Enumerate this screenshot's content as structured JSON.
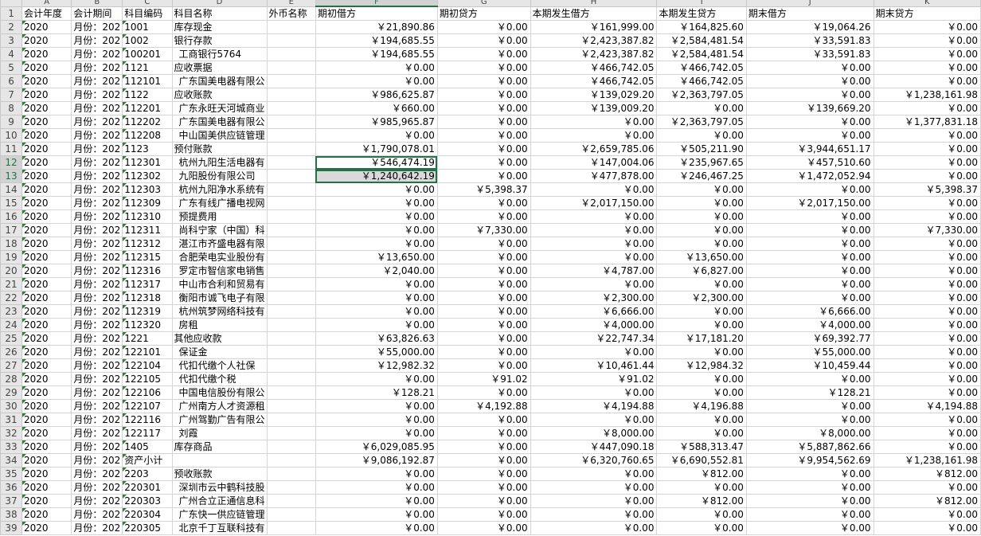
{
  "columns": [
    "A",
    "B",
    "C",
    "D",
    "E",
    "F",
    "G",
    "H",
    "I",
    "J",
    "K"
  ],
  "headers": [
    "会计年度",
    "会计期间",
    "科目编码",
    "科目名称",
    "外币名称",
    "期初借方",
    "期初贷方",
    "本期发生借方",
    "本期发生贷方",
    "期末借方",
    "期末贷方"
  ],
  "rows": [
    [
      "2020",
      "月份：202",
      "1001",
      "库存现金",
      "",
      "￥21,890.86",
      "￥0.00",
      "￥161,999.00",
      "￥164,825.60",
      "￥19,064.26",
      "￥0.00"
    ],
    [
      "2020",
      "月份：202",
      "1002",
      "银行存款",
      "",
      "￥194,685.55",
      "￥0.00",
      "￥2,423,387.82",
      "￥2,584,481.54",
      "￥33,591.83",
      "￥0.00"
    ],
    [
      "2020",
      "月份：202",
      "100201",
      "工商银行5764",
      "",
      "￥194,685.55",
      "￥0.00",
      "￥2,423,387.82",
      "￥2,584,481.54",
      "￥33,591.83",
      "￥0.00"
    ],
    [
      "2020",
      "月份：202",
      "1121",
      "应收票据",
      "",
      "￥0.00",
      "￥0.00",
      "￥466,742.05",
      "￥466,742.05",
      "￥0.00",
      "￥0.00"
    ],
    [
      "2020",
      "月份：202",
      "112101",
      "广东国美电器有限公",
      "",
      "￥0.00",
      "￥0.00",
      "￥466,742.05",
      "￥466,742.05",
      "￥0.00",
      "￥0.00"
    ],
    [
      "2020",
      "月份：202",
      "1122",
      "应收账款",
      "",
      "￥986,625.87",
      "￥0.00",
      "￥139,029.20",
      "￥2,363,797.05",
      "￥0.00",
      "￥1,238,161.98"
    ],
    [
      "2020",
      "月份：202",
      "112201",
      "广东永旺天河城商业",
      "",
      "￥660.00",
      "￥0.00",
      "￥139,009.20",
      "￥0.00",
      "￥139,669.20",
      "￥0.00"
    ],
    [
      "2020",
      "月份：202",
      "112202",
      "广东国美电器有限公",
      "",
      "￥985,965.87",
      "￥0.00",
      "￥0.00",
      "￥2,363,797.05",
      "￥0.00",
      "￥1,377,831.18"
    ],
    [
      "2020",
      "月份：202",
      "112208",
      "中山国美供应链管理",
      "",
      "￥0.00",
      "￥0.00",
      "￥0.00",
      "￥0.00",
      "￥0.00",
      "￥0.00"
    ],
    [
      "2020",
      "月份：202",
      "1123",
      "预付账款",
      "",
      "￥1,790,078.01",
      "￥0.00",
      "￥2,659,785.06",
      "￥505,211.90",
      "￥3,944,651.17",
      "￥0.00"
    ],
    [
      "2020",
      "月份：202",
      "112301",
      "杭州九阳生活电器有",
      "",
      "￥546,474.19",
      "￥0.00",
      "￥147,004.06",
      "￥235,967.65",
      "￥457,510.60",
      "￥0.00"
    ],
    [
      "2020",
      "月份：202",
      "112302",
      "九阳股份有限公司",
      "",
      "￥1,240,642.19",
      "￥0.00",
      "￥477,878.00",
      "￥246,467.25",
      "￥1,472,052.94",
      "￥0.00"
    ],
    [
      "2020",
      "月份：202",
      "112303",
      "杭州九阳净水系统有",
      "",
      "￥0.00",
      "￥5,398.37",
      "￥0.00",
      "￥0.00",
      "￥0.00",
      "￥5,398.37"
    ],
    [
      "2020",
      "月份：202",
      "112309",
      "广东有线广播电视网",
      "",
      "￥0.00",
      "￥0.00",
      "￥2,017,150.00",
      "￥0.00",
      "￥2,017,150.00",
      "￥0.00"
    ],
    [
      "2020",
      "月份：202",
      "112310",
      "预提费用",
      "",
      "￥0.00",
      "￥0.00",
      "￥0.00",
      "￥0.00",
      "￥0.00",
      "￥0.00"
    ],
    [
      "2020",
      "月份：202",
      "112311",
      "尚科宁家（中国）科",
      "",
      "￥0.00",
      "￥7,330.00",
      "￥0.00",
      "￥0.00",
      "￥0.00",
      "￥7,330.00"
    ],
    [
      "2020",
      "月份：202",
      "112312",
      "湛江市齐盛电器有限",
      "",
      "￥0.00",
      "￥0.00",
      "￥0.00",
      "￥0.00",
      "￥0.00",
      "￥0.00"
    ],
    [
      "2020",
      "月份：202",
      "112315",
      "合肥荣电实业股份有",
      "",
      "￥13,650.00",
      "￥0.00",
      "￥0.00",
      "￥13,650.00",
      "￥0.00",
      "￥0.00"
    ],
    [
      "2020",
      "月份：202",
      "112316",
      "罗定市智信家电销售",
      "",
      "￥2,040.00",
      "￥0.00",
      "￥4,787.00",
      "￥6,827.00",
      "￥0.00",
      "￥0.00"
    ],
    [
      "2020",
      "月份：202",
      "112317",
      "中山市合利和贸易有",
      "",
      "￥0.00",
      "￥0.00",
      "￥0.00",
      "￥0.00",
      "￥0.00",
      "￥0.00"
    ],
    [
      "2020",
      "月份：202",
      "112318",
      "衡阳市诚飞电子有限",
      "",
      "￥0.00",
      "￥0.00",
      "￥2,300.00",
      "￥2,300.00",
      "￥0.00",
      "￥0.00"
    ],
    [
      "2020",
      "月份：202",
      "112319",
      "杭州筑梦网络科技有",
      "",
      "￥0.00",
      "￥0.00",
      "￥6,666.00",
      "￥0.00",
      "￥6,666.00",
      "￥0.00"
    ],
    [
      "2020",
      "月份：202",
      "112320",
      "房租",
      "",
      "￥0.00",
      "￥0.00",
      "￥4,000.00",
      "￥0.00",
      "￥4,000.00",
      "￥0.00"
    ],
    [
      "2020",
      "月份：202",
      "1221",
      "其他应收款",
      "",
      "￥63,826.63",
      "￥0.00",
      "￥22,747.34",
      "￥17,181.20",
      "￥69,392.77",
      "￥0.00"
    ],
    [
      "2020",
      "月份：202",
      "122101",
      "保证金",
      "",
      "￥55,000.00",
      "￥0.00",
      "￥0.00",
      "￥0.00",
      "￥55,000.00",
      "￥0.00"
    ],
    [
      "2020",
      "月份：202",
      "122104",
      "代扣代缴个人社保",
      "",
      "￥12,982.32",
      "￥0.00",
      "￥10,461.44",
      "￥12,984.32",
      "￥10,459.44",
      "￥0.00"
    ],
    [
      "2020",
      "月份：202",
      "122105",
      "代扣代缴个税",
      "",
      "￥0.00",
      "￥91.02",
      "￥91.02",
      "￥0.00",
      "￥0.00",
      "￥0.00"
    ],
    [
      "2020",
      "月份：202",
      "122106",
      "中国电信股份有限公",
      "",
      "￥128.21",
      "￥0.00",
      "￥0.00",
      "￥0.00",
      "￥128.21",
      "￥0.00"
    ],
    [
      "2020",
      "月份：202",
      "122107",
      "广州南方人才资源租",
      "",
      "￥0.00",
      "￥4,192.88",
      "￥4,194.88",
      "￥4,196.88",
      "￥0.00",
      "￥4,194.88"
    ],
    [
      "2020",
      "月份：202",
      "122116",
      "广州驾勤广告有限公",
      "",
      "￥0.00",
      "￥0.00",
      "￥0.00",
      "￥0.00",
      "￥0.00",
      "￥0.00"
    ],
    [
      "2020",
      "月份：202",
      "122117",
      "刘霞",
      "",
      "￥0.00",
      "￥0.00",
      "￥8,000.00",
      "￥0.00",
      "￥8,000.00",
      "￥0.00"
    ],
    [
      "2020",
      "月份：202",
      "1405",
      "库存商品",
      "",
      "￥6,029,085.95",
      "￥0.00",
      "￥447,090.18",
      "￥588,313.47",
      "￥5,887,862.66",
      "￥0.00"
    ],
    [
      "2020",
      "月份：202",
      "资产小计",
      "",
      "",
      "￥9,086,192.87",
      "￥0.00",
      "￥6,320,760.65",
      "￥6,690,552.81",
      "￥9,954,562.69",
      "￥1,238,161.98"
    ],
    [
      "2020",
      "月份：202",
      "2203",
      "预收账款",
      "",
      "￥0.00",
      "￥0.00",
      "￥0.00",
      "￥812.00",
      "￥0.00",
      "￥812.00"
    ],
    [
      "2020",
      "月份：202",
      "220301",
      "深圳市云中鹤科技股",
      "",
      "￥0.00",
      "￥0.00",
      "￥0.00",
      "￥0.00",
      "￥0.00",
      "￥0.00"
    ],
    [
      "2020",
      "月份：202",
      "220303",
      "广州合立正通信息科",
      "",
      "￥0.00",
      "￥0.00",
      "￥0.00",
      "￥812.00",
      "￥0.00",
      "￥812.00"
    ],
    [
      "2020",
      "月份：202",
      "220304",
      "广东快一供应链管理",
      "",
      "￥0.00",
      "￥0.00",
      "￥0.00",
      "￥0.00",
      "￥0.00",
      "￥0.00"
    ],
    [
      "2020",
      "月份：202",
      "220305",
      "北京千丁互联科技有",
      "",
      "￥0.00",
      "￥0.00",
      "￥0.00",
      "￥0.00",
      "￥0.00",
      "￥0.00"
    ]
  ]
}
